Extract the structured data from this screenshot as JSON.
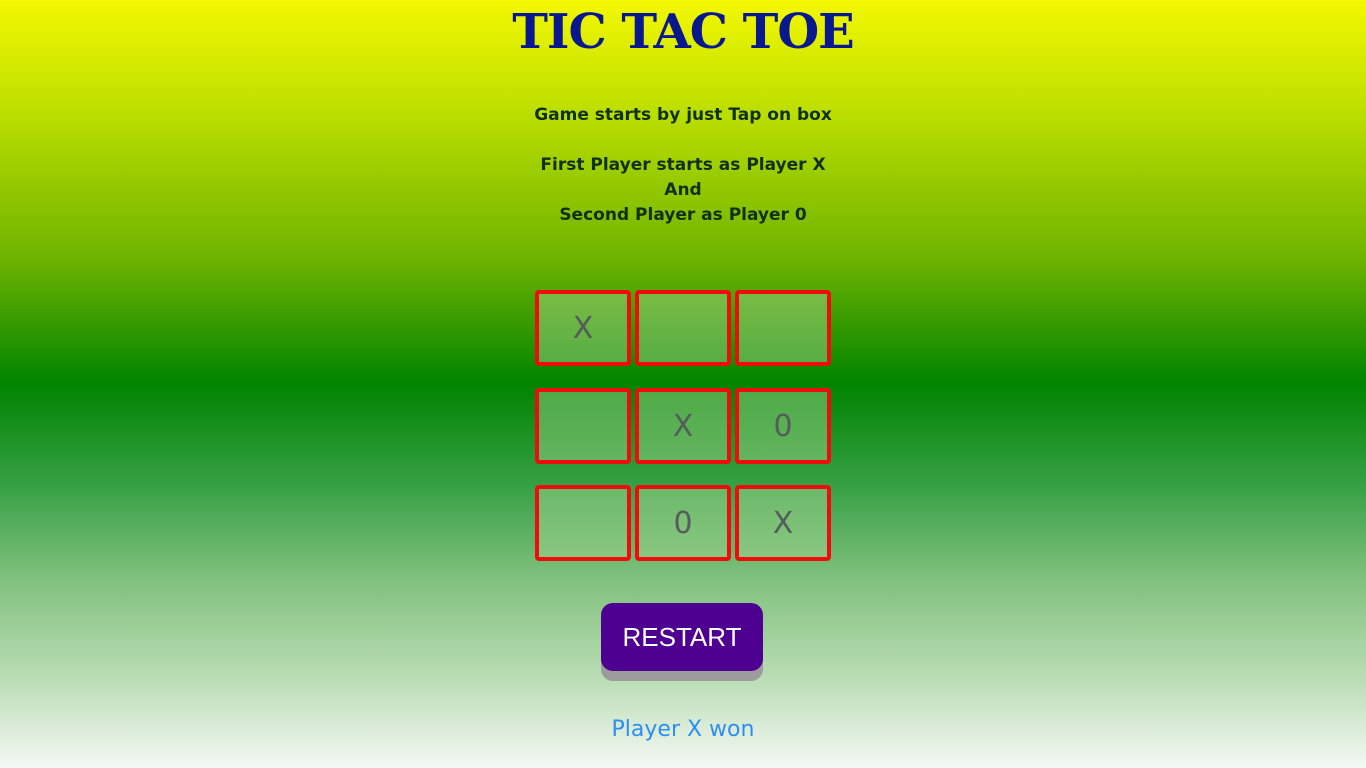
{
  "title": "TIC TAC TOE",
  "instructions": {
    "line1": "Game starts by just Tap on box",
    "line2": "First Player starts as Player X",
    "line3": "And",
    "line4": "Second Player as Player 0"
  },
  "board": {
    "cells": [
      "X",
      "",
      "",
      "",
      "X",
      "0",
      "",
      "0",
      "X"
    ]
  },
  "restart_label": "RESTART",
  "status": "Player X won",
  "colors": {
    "title": "#0a1890",
    "cell_border": "#f00c0c",
    "button_bg": "#4e0090",
    "status_text": "#2d8ef2"
  }
}
